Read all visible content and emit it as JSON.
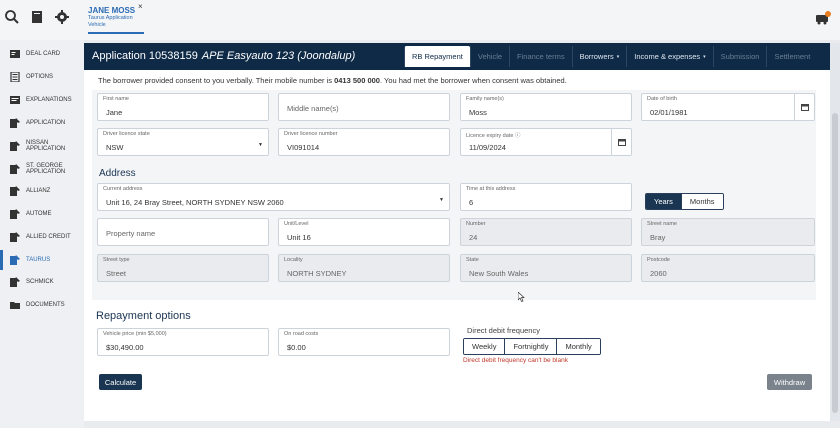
{
  "topbar": {
    "user_name": "JANE MOSS",
    "user_sub1": "Taurus Application",
    "user_sub2": "Vehicle",
    "close": "×"
  },
  "sidebar": {
    "items": [
      {
        "label": "DEAL CARD",
        "icon": "deal-card-icon"
      },
      {
        "label": "OPTIONS",
        "icon": "options-icon"
      },
      {
        "label": "EXPLANATIONS",
        "icon": "explanations-icon"
      },
      {
        "label": "APPLICATION",
        "icon": "application-icon"
      },
      {
        "label": "NISSAN APPLICATION",
        "icon": "application-icon"
      },
      {
        "label": "ST. GEORGE APPLICATION",
        "icon": "application-icon"
      },
      {
        "label": "ALLIANZ",
        "icon": "application-icon"
      },
      {
        "label": "AUTOME",
        "icon": "application-icon"
      },
      {
        "label": "ALLIED CREDIT",
        "icon": "application-icon"
      },
      {
        "label": "TAURUS",
        "icon": "application-icon"
      },
      {
        "label": "SCHMICK",
        "icon": "application-icon"
      },
      {
        "label": "DOCUMENTS",
        "icon": "folder-icon"
      }
    ],
    "active_index": 9
  },
  "header": {
    "app_number": "Application 10538159",
    "app_dealer": "APE Easyauto 123 (Joondalup)",
    "tabs": [
      {
        "label": "RB Repayment",
        "state": "active"
      },
      {
        "label": "Vehicle",
        "state": "disabled"
      },
      {
        "label": "Finance terms",
        "state": "disabled"
      },
      {
        "label": "Borrowers",
        "state": "enabled",
        "caret": "▾"
      },
      {
        "label": "Income & expenses",
        "state": "enabled",
        "caret": "▾"
      },
      {
        "label": "Submission",
        "state": "disabled"
      },
      {
        "label": "Settlement",
        "state": "disabled"
      }
    ]
  },
  "consent": {
    "text1": "The borrower provided consent to you verbally. Their mobile number is ",
    "mobile": "0413 500 000",
    "text2": ". You had met the borrower when consent was obtained."
  },
  "personal": {
    "first_name": {
      "label": "First name",
      "value": "Jane"
    },
    "middle_name": {
      "placeholder": "Middle name(s)"
    },
    "family_name": {
      "label": "Family name(s)",
      "value": "Moss"
    },
    "dob": {
      "label": "Date of birth",
      "value": "02/01/1981"
    },
    "licence_state": {
      "label": "Driver licence state",
      "value": "NSW"
    },
    "licence_number": {
      "label": "Driver licence number",
      "value": "VI091014"
    },
    "licence_expiry": {
      "label": "Licence expiry date",
      "value": "11/09/2024"
    }
  },
  "address": {
    "title": "Address",
    "current": {
      "label": "Current address",
      "value": "Unit 16, 24 Bray Street, NORTH SYDNEY NSW 2060"
    },
    "time_at": {
      "label": "Time at this address",
      "value": "6"
    },
    "time_units": {
      "options": [
        "Years",
        "Months"
      ],
      "selected": "Years"
    },
    "property_name": {
      "placeholder": "Property name"
    },
    "unit": {
      "label": "Unit/Level",
      "value": "Unit 16"
    },
    "number": {
      "label": "Number",
      "value": "24"
    },
    "street_name": {
      "label": "Street name",
      "value": "Bray"
    },
    "street_type": {
      "label": "Street type",
      "value": "Street"
    },
    "locality": {
      "label": "Locality",
      "value": "NORTH SYDNEY"
    },
    "state": {
      "label": "State",
      "value": "New South Wales"
    },
    "postcode": {
      "label": "Postcode",
      "value": "2060"
    }
  },
  "repayment": {
    "title": "Repayment options",
    "vehicle_price": {
      "label": "Vehicle price (min $5,000)",
      "value": "$30,490.00"
    },
    "on_road": {
      "label": "On road costs",
      "value": "$0.00"
    },
    "frequency_label": "Direct debit frequency",
    "frequency_options": [
      "Weekly",
      "Fortnightly",
      "Monthly"
    ],
    "frequency_error": "Direct debit frequency can't be blank"
  },
  "buttons": {
    "calculate": "Calculate",
    "withdraw": "Withdraw"
  },
  "colors": {
    "header_bg": "#0e2a47",
    "accent": "#2a6bb3",
    "error": "#c0392b"
  }
}
